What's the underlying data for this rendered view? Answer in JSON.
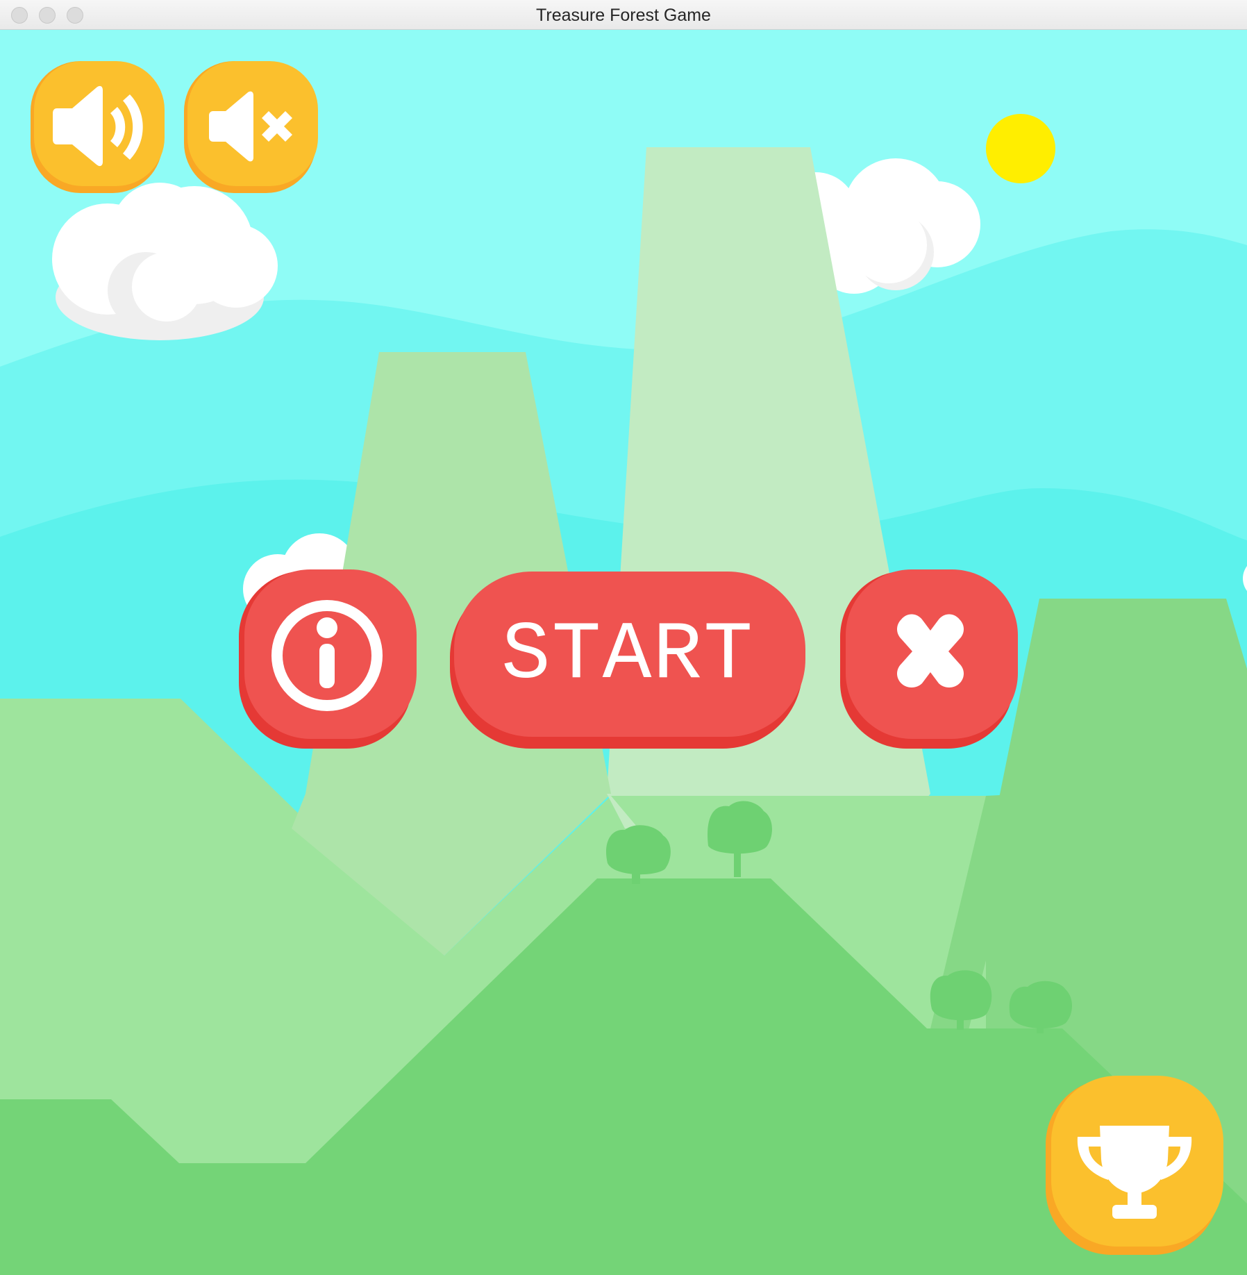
{
  "window": {
    "title": "Treasure Forest Game"
  },
  "menu": {
    "start_label": "START"
  },
  "colors": {
    "sky_top": "#8ffcf6",
    "sky_band": "#72f6f1",
    "sky_low": "#5cf2ec",
    "button_red": "#ef5350",
    "button_red_shadow": "#e53935",
    "button_orange": "#fbc02d",
    "button_orange_shadow": "#f9a825",
    "sun": "#ffee00",
    "hill_front": "#74d477",
    "hill_mid": "#9ee49d",
    "mountain_left": "#ade4a9",
    "mountain_right": "#c2ebc2"
  },
  "icons": {
    "sound_on": "speaker-on-icon",
    "sound_off": "speaker-mute-icon",
    "info": "info-icon",
    "exit": "close-icon",
    "trophy": "trophy-icon"
  }
}
